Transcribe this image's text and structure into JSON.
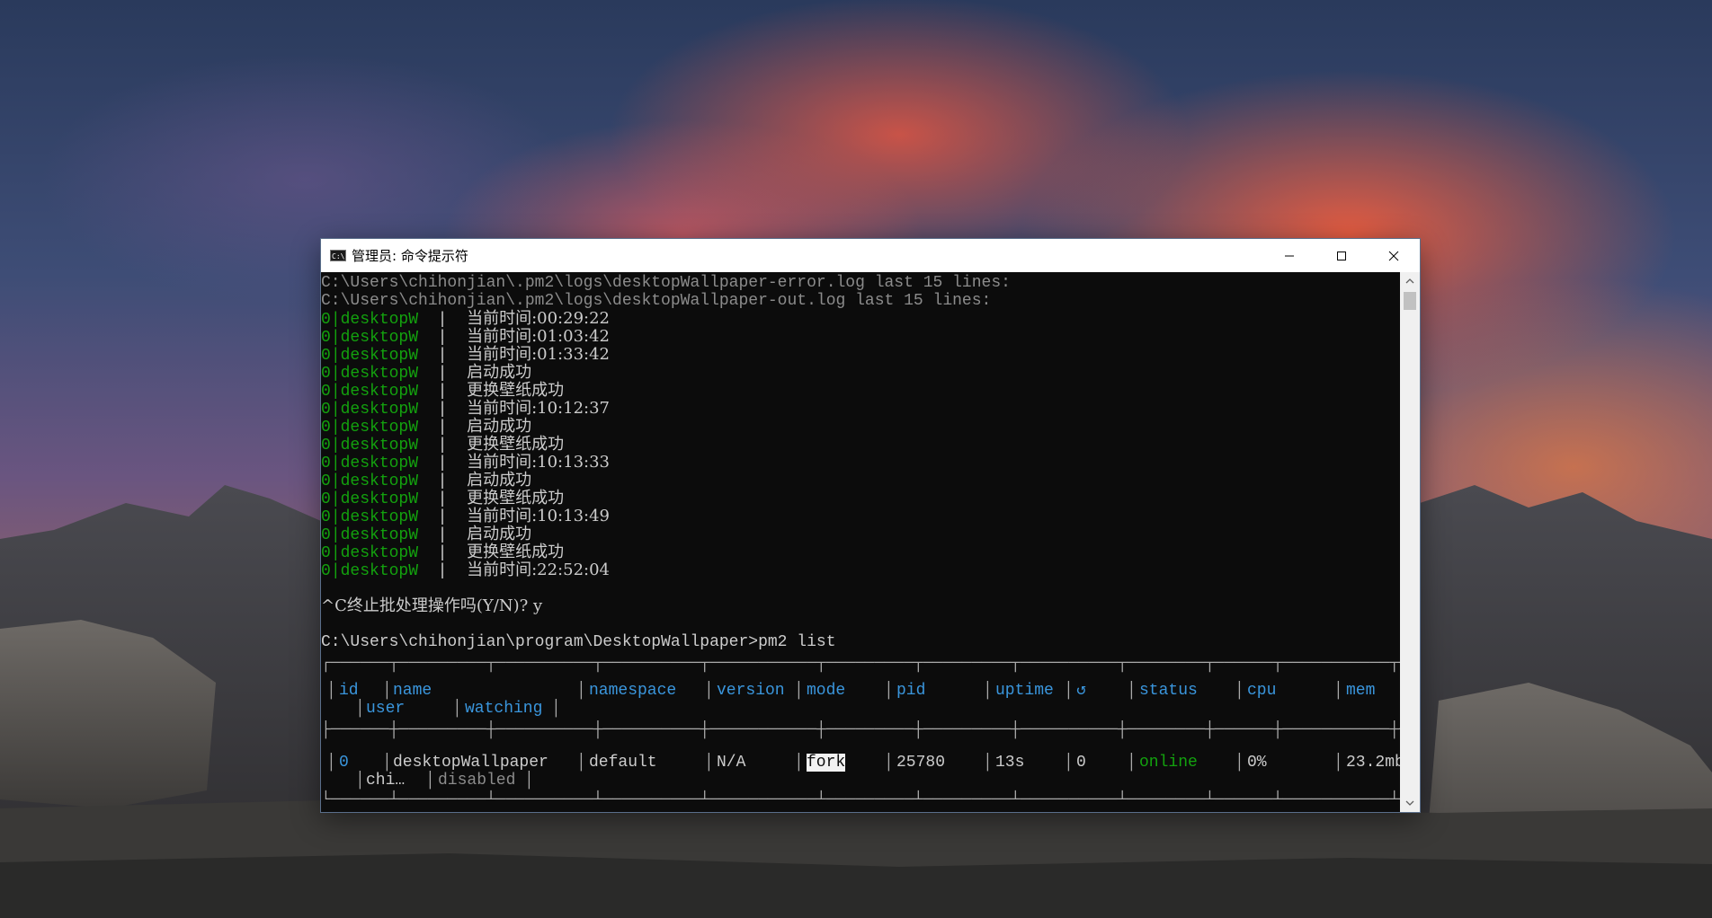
{
  "window": {
    "title": "管理员: 命令提示符",
    "icon": "cmd-icon",
    "icon_text": "C:\\"
  },
  "console": {
    "header_lines": [
      "C:\\Users\\chihonjian\\.pm2\\logs\\desktopWallpaper-error.log last 15 lines:",
      "C:\\Users\\chihonjian\\.pm2\\logs\\desktopWallpaper-out.log last 15 lines:"
    ],
    "log_prefix_id": "0",
    "log_prefix_name": "desktopW",
    "log_sep": "|",
    "log_messages": [
      "当前时间:00:29:22",
      "当前时间:01:03:42",
      "当前时间:01:33:42",
      "启动成功",
      "更换壁纸成功",
      "当前时间:10:12:37",
      "启动成功",
      "更换壁纸成功",
      "当前时间:10:13:33",
      "启动成功",
      "更换壁纸成功",
      "当前时间:10:13:49",
      "启动成功",
      "更换壁纸成功",
      "当前时间:22:52:04"
    ],
    "batch_prompt": "^C终止批处理操作吗(Y/N)? y",
    "command_line": "C:\\Users\\chihonjian\\program\\DesktopWallpaper>pm2 list"
  },
  "pm2_table": {
    "headers": {
      "id": "id",
      "name": "name",
      "user": "user",
      "watching": "watching",
      "namespace": "namespace",
      "version": "version",
      "mode": "mode",
      "pid": "pid",
      "uptime": "uptime",
      "restarts": "↺",
      "status": "status",
      "cpu": "cpu",
      "mem": "mem"
    },
    "rows": [
      {
        "id": "0",
        "name": "desktopWallpaper",
        "user": "chi…",
        "watching": "disabled",
        "namespace": "default",
        "version": "N/A",
        "mode": "fork",
        "pid": "25780",
        "uptime": "13s",
        "restarts": "0",
        "status": "online",
        "cpu": "0%",
        "mem": "23.2mb"
      }
    ]
  },
  "colors": {
    "console_bg": "#0c0c0c",
    "console_text": "#cccccc",
    "pm2_green": "#13a10e",
    "pm2_cyan": "#3a96dd"
  }
}
